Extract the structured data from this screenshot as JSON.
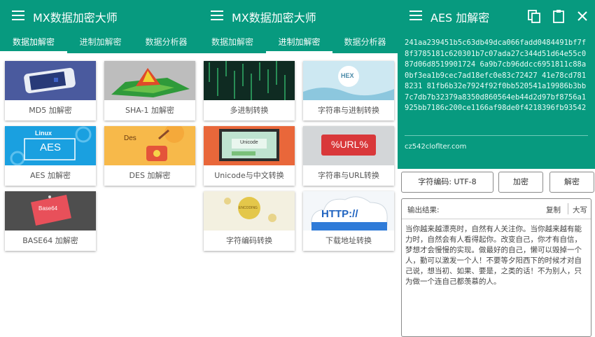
{
  "panels": [
    {
      "title": "MX数据加密大师",
      "tabs": [
        "数据加解密",
        "进制加解密",
        "数据分析器"
      ],
      "active_tab": 0,
      "cards": [
        {
          "label": "MD5 加解密"
        },
        {
          "label": "SHA-1 加解密"
        },
        {
          "label": "AES 加解密",
          "thumb_text": "AES",
          "badge": "Linux"
        },
        {
          "label": "DES 加解密",
          "thumb_text": "Des"
        },
        {
          "label": "BASE64 加解密",
          "thumb_text": "Base64"
        }
      ]
    },
    {
      "title": "MX数据加密大师",
      "tabs": [
        "数据加解密",
        "进制加解密",
        "数据分析器"
      ],
      "active_tab": 1,
      "cards": [
        {
          "label": "多进制转换"
        },
        {
          "label": "字符串与进制转换",
          "thumb_text": "HEX"
        },
        {
          "label": "Unicode与中文转换",
          "thumb_text": "Unicode"
        },
        {
          "label": "字符串与URL转换",
          "thumb_text": "%URL%"
        },
        {
          "label": "字符编码转换",
          "thumb_text": "ENCODING"
        },
        {
          "label": "下载地址转换",
          "thumb_text": "HTTP://"
        }
      ]
    }
  ],
  "aes_screen": {
    "title": "AES 加解密",
    "output_hex": "241aa239451b5c63db49dca066fadd0484491bf7f8f3785181c620301b7c07ada27c344d51d64e55c087d06d8519901724 6a9b7cb96ddcc6951811c88a0bf3ea1b9cec7ad18efc0e83c72427 41e78cd7818231 81fb6b32e7924f92f0bb520541a19986b3bb7c7db7b32379a8350d860564eb44d2d97bf8756a1925bb7186c200ce1166af98de0f4218396fb93542",
    "email": "cz542cloflter.com",
    "buttons": {
      "encoding": "字符编码: UTF-8",
      "encrypt": "加密",
      "decrypt": "解密"
    },
    "result": {
      "title": "输出结果:",
      "copy": "复制",
      "upper": "大写",
      "text": "当你越来越漂亮时，自然有人关注你。当你越来越有能力时，自然会有人看得起你。改变自己，你才有自信，梦想才会慢慢的实现。做最好的自己，懒可以毁掉一个人，勤可以激发一个人！不要等夕阳西下的时候才对自己说，想当初、如果、要是，之类的话！不为别人，只为做一个连自己都羡慕的人。"
    }
  },
  "colors": {
    "primary": "#079a7f",
    "white": "#ffffff",
    "label": "#555555"
  }
}
